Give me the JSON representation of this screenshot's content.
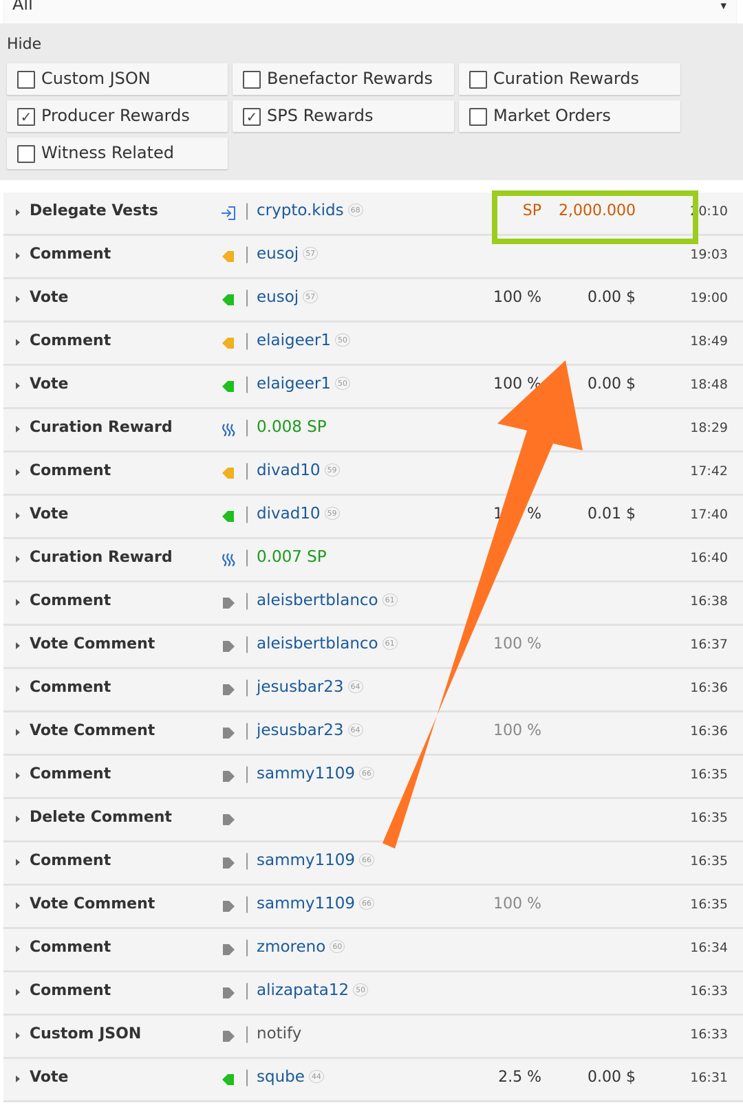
{
  "filter_select": {
    "value": "All"
  },
  "hide": {
    "label": "Hide",
    "options": [
      {
        "label": "Custom JSON",
        "checked": false
      },
      {
        "label": "Benefactor Rewards",
        "checked": false
      },
      {
        "label": "Curation Rewards",
        "checked": false
      },
      {
        "label": "Producer Rewards",
        "checked": true
      },
      {
        "label": "SPS Rewards",
        "checked": true
      },
      {
        "label": "Market Orders",
        "checked": false
      },
      {
        "label": "Witness Related",
        "checked": false
      }
    ]
  },
  "operations": [
    {
      "type": "Delegate Vests",
      "icon": "delegate-icon",
      "who": "crypto.kids",
      "rep": "68",
      "pct": "SP",
      "amt": "2,000.000",
      "time": "20:10",
      "who_style": "link",
      "amt_style": "orange"
    },
    {
      "type": "Comment",
      "icon": "comment-yellow-icon",
      "who": "eusoj",
      "rep": "57",
      "pct": "",
      "amt": "",
      "time": "19:03",
      "who_style": "link"
    },
    {
      "type": "Vote",
      "icon": "vote-green-icon",
      "who": "eusoj",
      "rep": "57",
      "pct": "100 %",
      "amt": "0.00 $",
      "time": "19:00",
      "who_style": "link"
    },
    {
      "type": "Comment",
      "icon": "comment-yellow-icon",
      "who": "elaigeer1",
      "rep": "50",
      "pct": "",
      "amt": "",
      "time": "18:49",
      "who_style": "link"
    },
    {
      "type": "Vote",
      "icon": "vote-green-icon",
      "who": "elaigeer1",
      "rep": "50",
      "pct": "100 %",
      "amt": "0.00 $",
      "time": "18:48",
      "who_style": "link"
    },
    {
      "type": "Curation Reward",
      "icon": "steem-icon",
      "who": "0.008 SP",
      "rep": "",
      "pct": "",
      "amt": "",
      "time": "18:29",
      "who_style": "green"
    },
    {
      "type": "Comment",
      "icon": "comment-yellow-icon",
      "who": "divad10",
      "rep": "59",
      "pct": "",
      "amt": "",
      "time": "17:42",
      "who_style": "link"
    },
    {
      "type": "Vote",
      "icon": "vote-green-icon",
      "who": "divad10",
      "rep": "59",
      "pct": "100 %",
      "amt": "0.01 $",
      "time": "17:40",
      "who_style": "link"
    },
    {
      "type": "Curation Reward",
      "icon": "steem-icon",
      "who": "0.007 SP",
      "rep": "",
      "pct": "",
      "amt": "",
      "time": "16:40",
      "who_style": "green"
    },
    {
      "type": "Comment",
      "icon": "play-grey-icon",
      "who": "aleisbertblanco",
      "rep": "61",
      "pct": "",
      "amt": "",
      "time": "16:38",
      "who_style": "link"
    },
    {
      "type": "Vote Comment",
      "icon": "play-grey-icon",
      "who": "aleisbertblanco",
      "rep": "61",
      "pct": "100 %",
      "amt": "",
      "time": "16:37",
      "who_style": "link",
      "pct_style": "grey"
    },
    {
      "type": "Comment",
      "icon": "play-grey-icon",
      "who": "jesusbar23",
      "rep": "64",
      "pct": "",
      "amt": "",
      "time": "16:36",
      "who_style": "link"
    },
    {
      "type": "Vote Comment",
      "icon": "play-grey-icon",
      "who": "jesusbar23",
      "rep": "64",
      "pct": "100 %",
      "amt": "",
      "time": "16:36",
      "who_style": "link",
      "pct_style": "grey"
    },
    {
      "type": "Comment",
      "icon": "play-grey-icon",
      "who": "sammy1109",
      "rep": "66",
      "pct": "",
      "amt": "",
      "time": "16:35",
      "who_style": "link"
    },
    {
      "type": "Delete Comment",
      "icon": "play-grey-icon",
      "who": "",
      "rep": "",
      "pct": "",
      "amt": "",
      "time": "16:35",
      "who_style": "none"
    },
    {
      "type": "Comment",
      "icon": "play-grey-icon",
      "who": "sammy1109",
      "rep": "66",
      "pct": "",
      "amt": "",
      "time": "16:35",
      "who_style": "link"
    },
    {
      "type": "Vote Comment",
      "icon": "play-grey-icon",
      "who": "sammy1109",
      "rep": "66",
      "pct": "100 %",
      "amt": "",
      "time": "16:35",
      "who_style": "link",
      "pct_style": "grey"
    },
    {
      "type": "Comment",
      "icon": "play-grey-icon",
      "who": "zmoreno",
      "rep": "60",
      "pct": "",
      "amt": "",
      "time": "16:34",
      "who_style": "link"
    },
    {
      "type": "Comment",
      "icon": "play-grey-icon",
      "who": "alizapata12",
      "rep": "50",
      "pct": "",
      "amt": "",
      "time": "16:33",
      "who_style": "link"
    },
    {
      "type": "Custom JSON",
      "icon": "play-grey-icon",
      "who": "notify",
      "rep": "",
      "pct": "",
      "amt": "",
      "time": "16:33",
      "who_style": "plain"
    },
    {
      "type": "Vote",
      "icon": "vote-green-icon",
      "who": "sqube",
      "rep": "44",
      "pct": "2.5 %",
      "amt": "0.00 $",
      "time": "16:31",
      "who_style": "link"
    }
  ],
  "colors": {
    "highlight_box": "#9ccd1e",
    "arrow": "#ff7424",
    "link": "#1a5a9a",
    "reward_green": "#1d9a1d",
    "delegate_orange": "#cc5a00"
  }
}
